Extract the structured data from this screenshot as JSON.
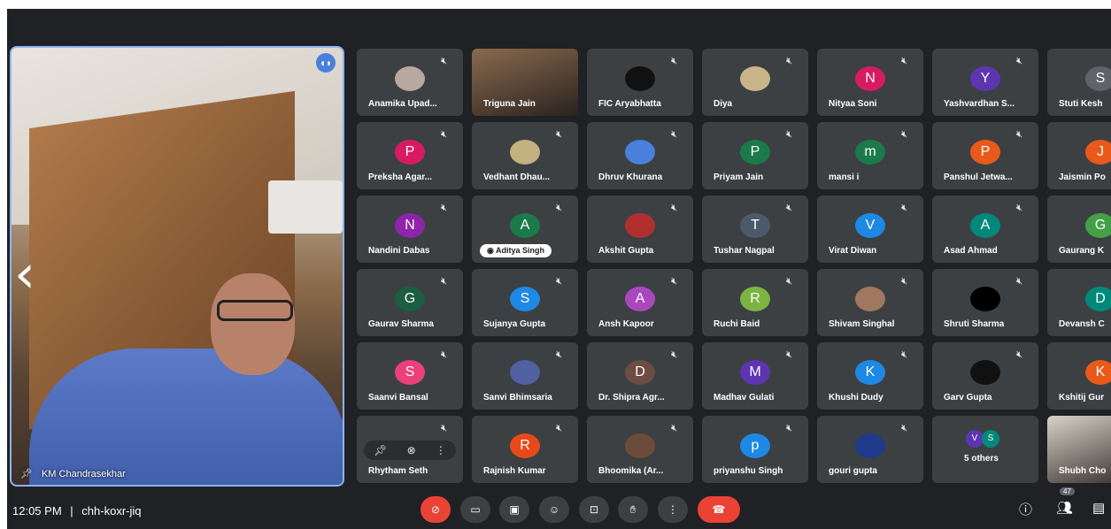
{
  "speaker": {
    "name": "KM Chandrasekhar"
  },
  "grid": [
    {
      "name": "Anamika Upad...",
      "type": "photo",
      "color": "#b7a8a0"
    },
    {
      "name": "Triguna Jain",
      "type": "video",
      "color": "#8a6a4e"
    },
    {
      "name": "FIC Aryabhatta",
      "type": "photo",
      "color": "#111111"
    },
    {
      "name": "Diya",
      "type": "photo",
      "color": "#c9b48a"
    },
    {
      "name": "Nityaa Soni",
      "type": "initial",
      "initial": "N",
      "color": "#d81b60"
    },
    {
      "name": "Yashvardhan S...",
      "type": "initial",
      "initial": "Y",
      "color": "#5e35b1"
    },
    {
      "name": "Stuti Kesh",
      "type": "initial",
      "initial": "S",
      "color": "#5f6368"
    },
    {
      "name": "Preksha Agar...",
      "type": "initial",
      "initial": "P",
      "color": "#d81b60"
    },
    {
      "name": "Vedhant Dhau...",
      "type": "photo",
      "color": "#c2b280"
    },
    {
      "name": "Dhruv Khurana",
      "type": "photo",
      "color": "#4a7fdc"
    },
    {
      "name": "Priyam Jain",
      "type": "initial",
      "initial": "P",
      "color": "#1b7a4a"
    },
    {
      "name": "mansi i",
      "type": "initial",
      "initial": "m",
      "color": "#1b7a4a"
    },
    {
      "name": "Panshul Jetwa...",
      "type": "initial",
      "initial": "P",
      "color": "#e8591a"
    },
    {
      "name": "Jaismin Po",
      "type": "initial",
      "initial": "J",
      "color": "#e8591a"
    },
    {
      "name": "Nandini Dabas",
      "type": "initial",
      "initial": "N",
      "color": "#8e24aa"
    },
    {
      "name": "Aditya Singh",
      "type": "initial",
      "initial": "A",
      "color": "#1b7a4a",
      "chip": true
    },
    {
      "name": "Akshit Gupta",
      "type": "photo",
      "color": "#b03030"
    },
    {
      "name": "Tushar Nagpal",
      "type": "initial",
      "initial": "T",
      "color": "#4a5a6a"
    },
    {
      "name": "Virat Diwan",
      "type": "initial",
      "initial": "V",
      "color": "#1e88e5"
    },
    {
      "name": "Asad Ahmad",
      "type": "initial",
      "initial": "A",
      "color": "#00897b"
    },
    {
      "name": "Gaurang K",
      "type": "initial",
      "initial": "G",
      "color": "#43a047"
    },
    {
      "name": "Gaurav Sharma",
      "type": "initial",
      "initial": "G",
      "color": "#1b5e40"
    },
    {
      "name": "Sujanya Gupta",
      "type": "initial",
      "initial": "S",
      "color": "#1e88e5"
    },
    {
      "name": "Ansh Kapoor",
      "type": "initial",
      "initial": "A",
      "color": "#ab47bc"
    },
    {
      "name": "Ruchi Baid",
      "type": "initial",
      "initial": "R",
      "color": "#7cb342"
    },
    {
      "name": "Shivam Singhal",
      "type": "photo",
      "color": "#a07860"
    },
    {
      "name": "Shruti Sharma",
      "type": "photo",
      "color": "#000000"
    },
    {
      "name": "Devansh C",
      "type": "initial",
      "initial": "D",
      "color": "#00897b"
    },
    {
      "name": "Saanvi Bansal",
      "type": "initial",
      "initial": "S",
      "color": "#ec407a"
    },
    {
      "name": "Sanvi Bhimsaria",
      "type": "photo",
      "color": "#5060a0"
    },
    {
      "name": "Dr. Shipra Agr...",
      "type": "initial",
      "initial": "D",
      "color": "#6d4c41"
    },
    {
      "name": "Madhav Gulati",
      "type": "initial",
      "initial": "M",
      "color": "#5e35b1"
    },
    {
      "name": "Khushi Dudy",
      "type": "initial",
      "initial": "K",
      "color": "#1e88e5"
    },
    {
      "name": "Garv Gupta",
      "type": "photo",
      "color": "#111111"
    },
    {
      "name": "Kshitij Gur",
      "type": "initial",
      "initial": "K",
      "color": "#e8591a"
    },
    {
      "name": "Rhytham Seth",
      "type": "controls",
      "color": "#3c4043"
    },
    {
      "name": "Rajnish Kumar",
      "type": "initial",
      "initial": "R",
      "color": "#e8491a"
    },
    {
      "name": "Bhoomika (Ar...",
      "type": "photo",
      "color": "#6b4b3a"
    },
    {
      "name": "priyanshu Singh",
      "type": "initial",
      "initial": "p",
      "color": "#1e88e5"
    },
    {
      "name": "gouri gupta",
      "type": "photo",
      "color": "#1e3a8a"
    },
    {
      "name": "5 others",
      "type": "others",
      "color": "#3c4043"
    },
    {
      "name": "Shubh Cho",
      "type": "video",
      "color": "#d8d2c8"
    }
  ],
  "bottom": {
    "time": "12:05 PM",
    "separator": "|",
    "meeting_code": "chh-koxr-jiq",
    "participants_count": "47"
  },
  "icons": {
    "mute": "muted-mic-icon",
    "pin": "pin-icon"
  },
  "colors": {
    "bg": "#202124",
    "tile": "#3c4043",
    "end_call": "#ea4335",
    "accent": "#8ab4f8"
  }
}
